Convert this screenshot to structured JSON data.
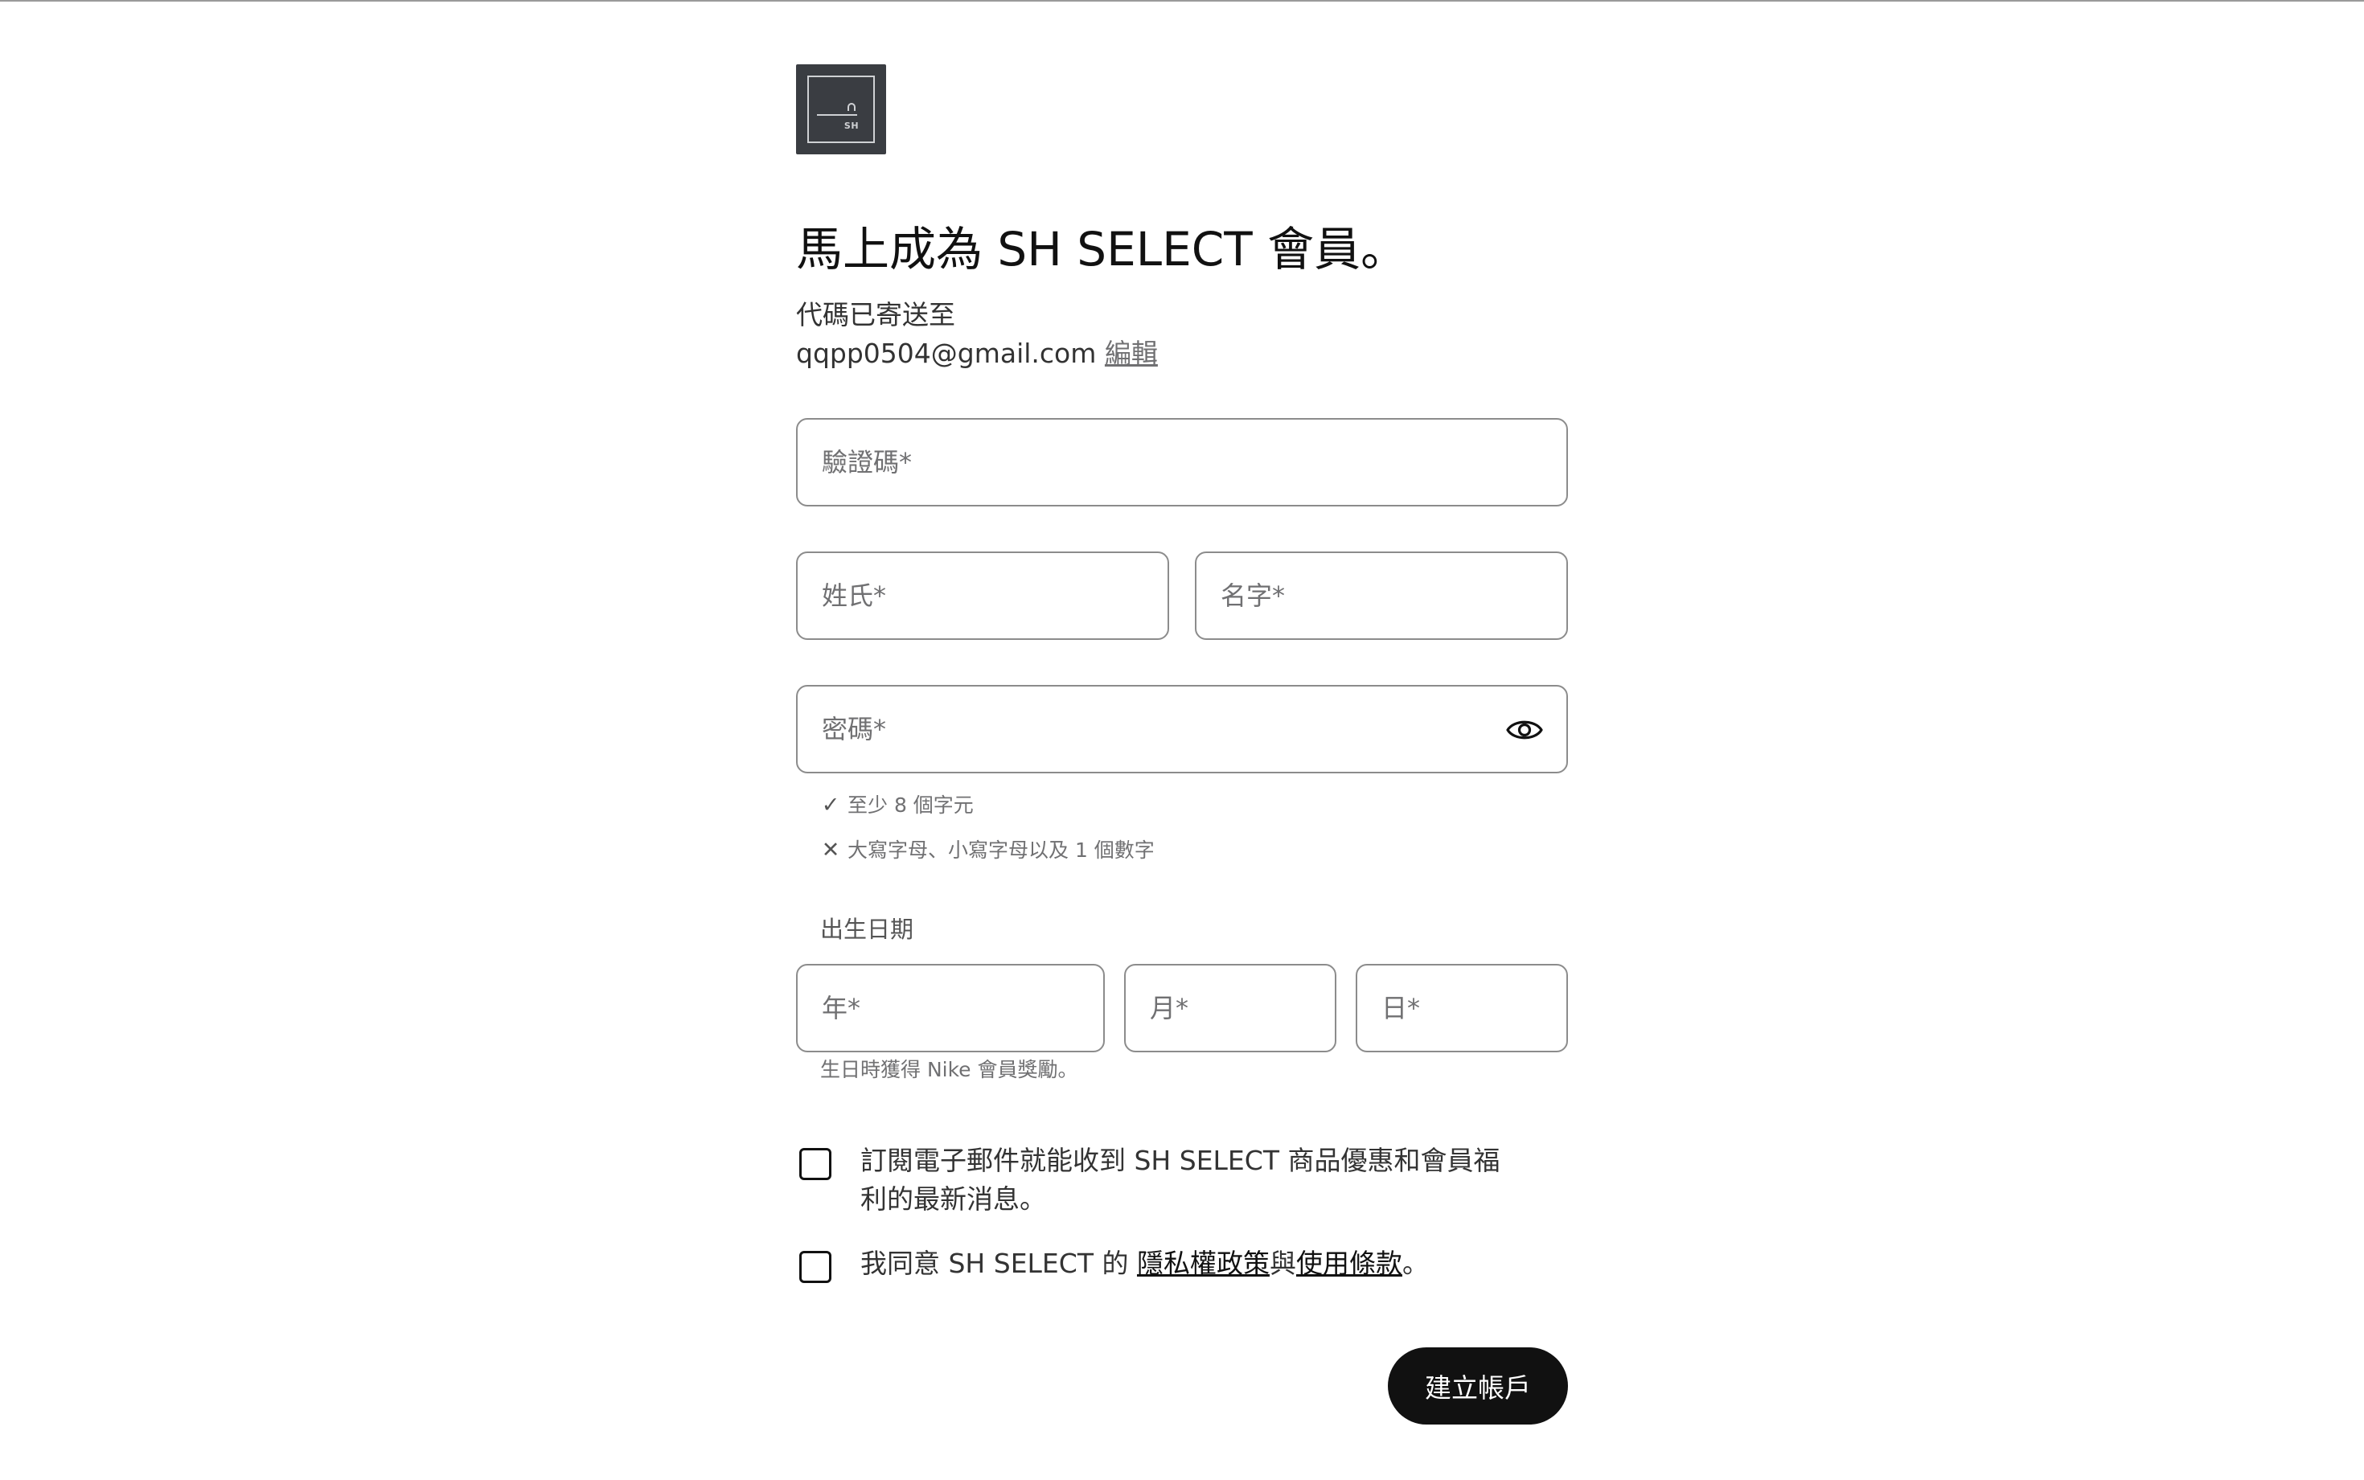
{
  "brand": {
    "logo_text": "SH"
  },
  "header": {
    "title": "馬上成為 SH SELECT 會員。",
    "code_sent_text": "代碼已寄送至",
    "email": "qqpp0504@gmail.com",
    "edit_link": "編輯"
  },
  "form": {
    "code_placeholder": "驗證碼*",
    "last_name_placeholder": "姓氏*",
    "first_name_placeholder": "名字*",
    "password_placeholder": "密碼*",
    "password_rules": [
      {
        "icon": "check-icon",
        "glyph": "✓",
        "text": "至少 8 個字元"
      },
      {
        "icon": "cross-icon",
        "glyph": "✕",
        "text": "大寫字母、小寫字母以及 1 個數字"
      }
    ],
    "dob_label": "出生日期",
    "year_placeholder": "年*",
    "month_placeholder": "月*",
    "day_placeholder": "日*",
    "dob_hint": "生日時獲得 Nike 會員獎勵。"
  },
  "consents": {
    "newsletter_text": "訂閱電子郵件就能收到 SH SELECT 商品優惠和會員福利的最新消息。",
    "agree_prefix": "我同意 SH SELECT 的 ",
    "privacy_link": "隱私權政策",
    "joiner": "與",
    "terms_link": "使用條款",
    "agree_suffix": "。"
  },
  "actions": {
    "submit_label": "建立帳戶"
  },
  "colors": {
    "primary": "#111111",
    "border": "#8c8c8c",
    "muted_text": "#707072",
    "logo_bg": "#3a3d42"
  }
}
